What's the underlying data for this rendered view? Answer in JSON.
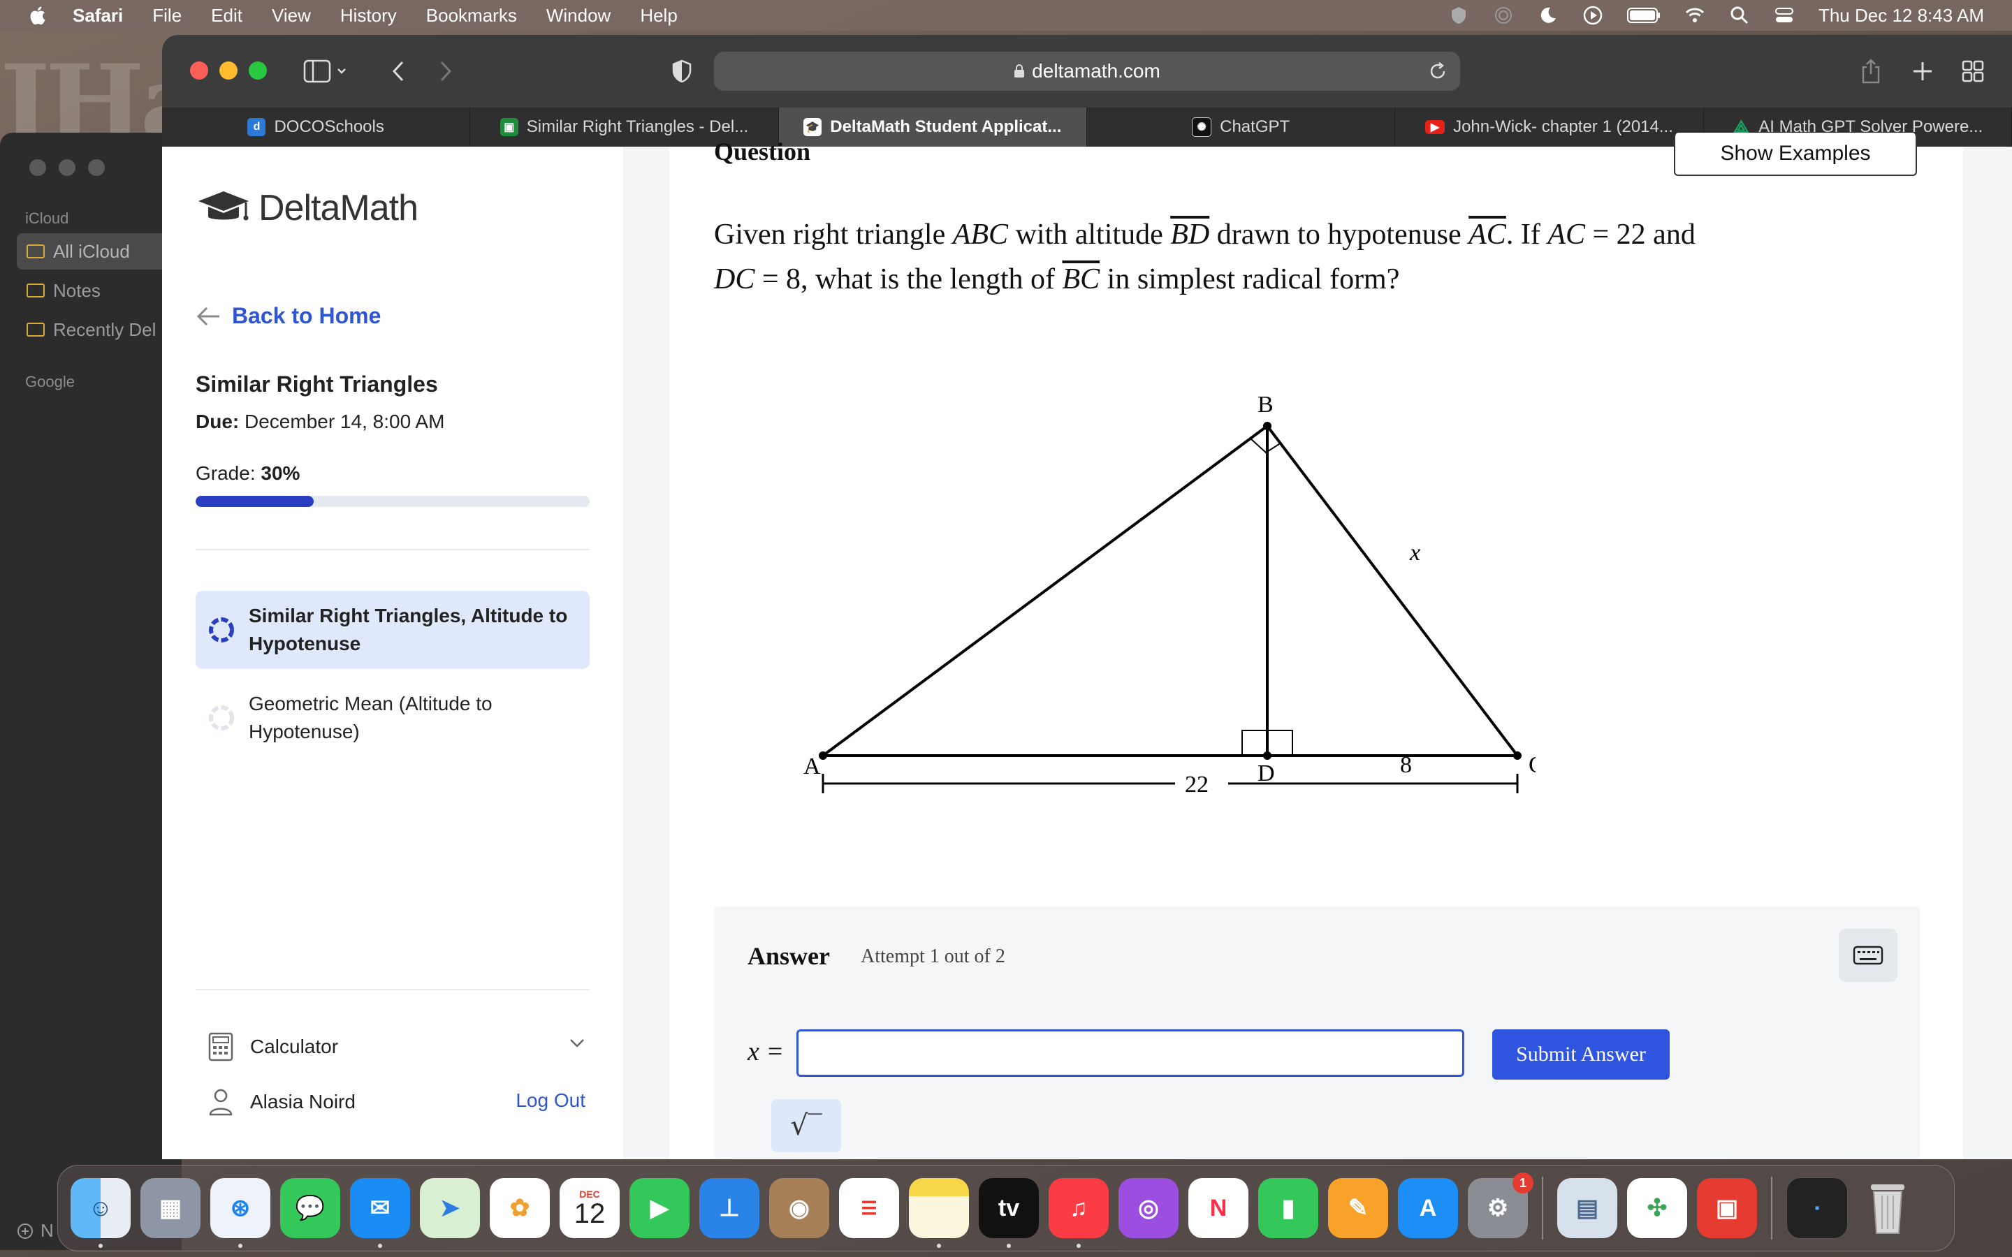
{
  "menubar": {
    "app": "Safari",
    "items": [
      "File",
      "Edit",
      "View",
      "History",
      "Bookmarks",
      "Window",
      "Help"
    ],
    "clock": "Thu Dec 12  8:43 AM"
  },
  "notes": {
    "section_icloud": "iCloud",
    "folders": [
      "All iCloud",
      "Notes",
      "Recently Del"
    ],
    "section_google": "Google",
    "new_note": "N"
  },
  "browser": {
    "url": "deltamath.com",
    "tabs": [
      {
        "label": "DOCOSchools",
        "color": "#2b7bd6"
      },
      {
        "label": "Similar Right Triangles - Del...",
        "color": "#1e8e3e"
      },
      {
        "label": "DeltaMath Student Applicat...",
        "color": "#ffffff"
      },
      {
        "label": "ChatGPT",
        "color": "#111111"
      },
      {
        "label": "John-Wick- chapter 1 (2014...",
        "color": "#e62117"
      },
      {
        "label": "AI Math GPT Solver Powere...",
        "color": "#1aa260"
      }
    ]
  },
  "sidebar": {
    "logo": "DeltaMath",
    "back": "Back to Home",
    "assignment_title": "Similar Right Triangles",
    "due_label": "Due:",
    "due_value": "December 14, 8:00 AM",
    "grade_label": "Grade:",
    "grade_value": "30%",
    "grade_fraction": 0.3,
    "skills": [
      {
        "label": "Similar Right Triangles, Altitude to Hypotenuse",
        "active": true
      },
      {
        "label": "Geometric Mean (Altitude to Hypotenuse)",
        "active": false
      }
    ],
    "calculator": "Calculator",
    "user_name": "Alasia Noird",
    "logout": "Log Out"
  },
  "question": {
    "heading": "Question",
    "show_examples": "Show Examples",
    "text_1": "Given right triangle ",
    "abc": "ABC",
    "text_2": " with altitude ",
    "bd": "BD",
    "text_3": " drawn to hypotenuse ",
    "ac": "AC",
    "text_4": ". If ",
    "ac_eq": "AC",
    "eq_22": " = 22 and",
    "dc": "DC",
    "eq_8": " = 8, what is the length of ",
    "bc": "BC",
    "text_5": " in simplest radical form?",
    "figure": {
      "label_a": "A",
      "label_b": "B",
      "label_c": "C",
      "label_d": "D",
      "label_x": "x",
      "label_dc": "8",
      "label_ac": "22"
    }
  },
  "answer": {
    "title": "Answer",
    "attempt": "Attempt 1 out of 2",
    "variable": "x =",
    "input_value": "",
    "submit": "Submit Answer",
    "sqrt_symbol": "√‾"
  },
  "dock": {
    "calendar_month": "DEC",
    "calendar_day": "12",
    "tv_label": "tv",
    "settings_badge": "1"
  }
}
